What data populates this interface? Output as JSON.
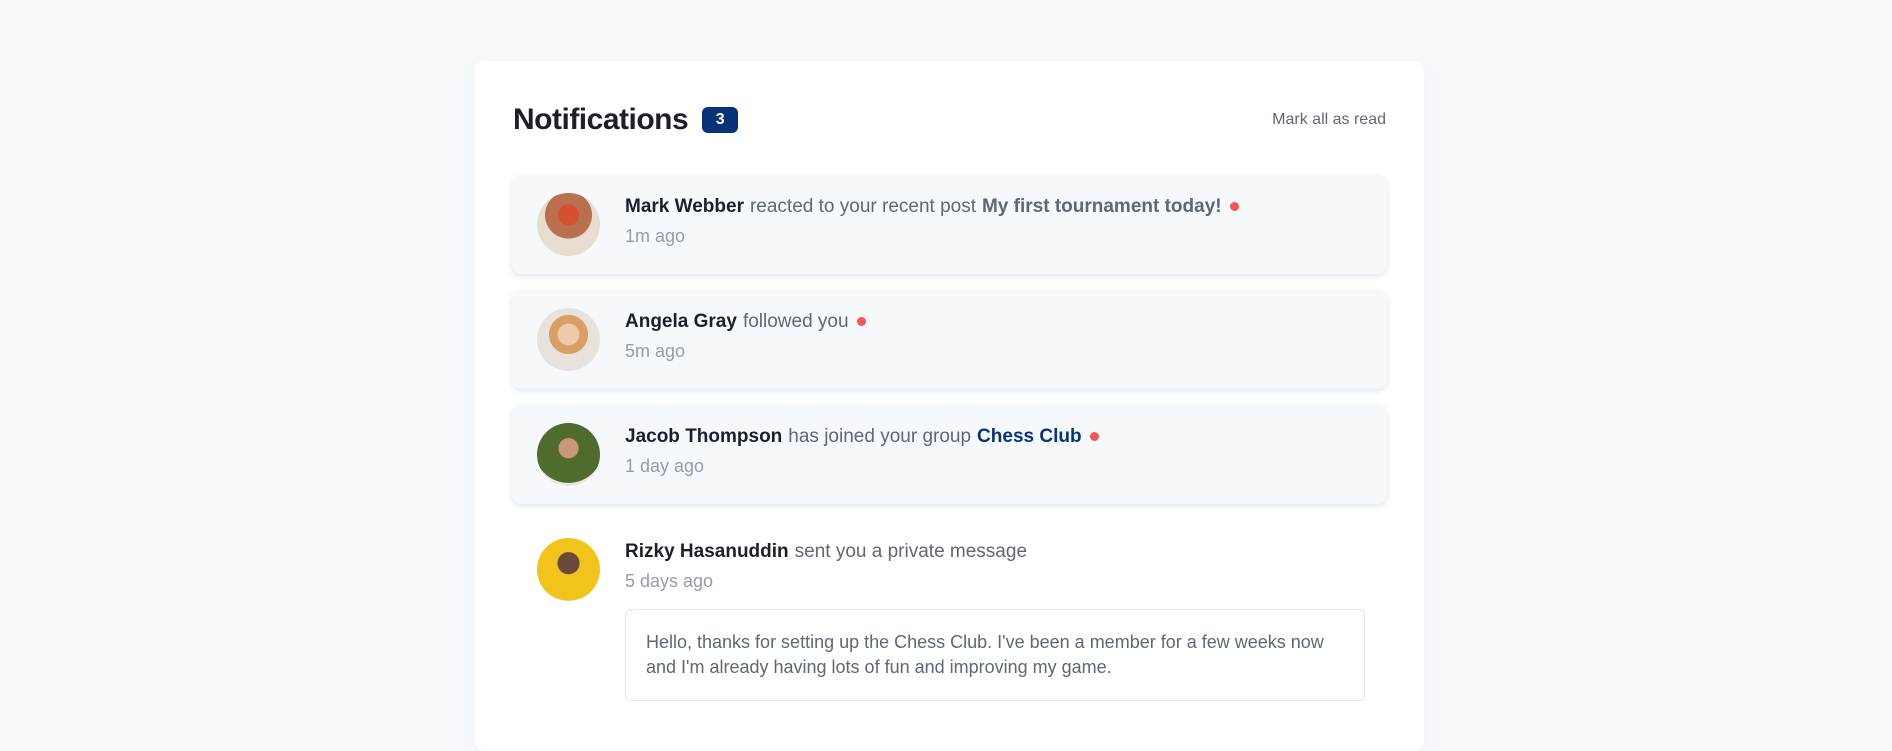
{
  "header": {
    "title": "Notifications",
    "unread_count": "3",
    "mark_all": "Mark all as read"
  },
  "colors": {
    "accent": "#0a327b",
    "dot": "#f65552",
    "unread_bg": "#f6f9fc"
  },
  "notifications": [
    {
      "name": "Mark Webber",
      "action": "reacted to your recent post",
      "target": "My first tournament today!",
      "time": "1m ago",
      "unread": true
    },
    {
      "name": "Angela Gray",
      "action": "followed you",
      "time": "5m ago",
      "unread": true
    },
    {
      "name": "Jacob Thompson",
      "action": "has joined your group",
      "target": "Chess Club",
      "time": "1 day ago",
      "unread": true
    },
    {
      "name": "Rizky Hasanuddin",
      "action": "sent you a private message",
      "time": "5 days ago",
      "unread": false,
      "message": "Hello, thanks for setting up the Chess Club. I've been a member for a few weeks now and I'm already having lots of fun and improving my game."
    }
  ]
}
